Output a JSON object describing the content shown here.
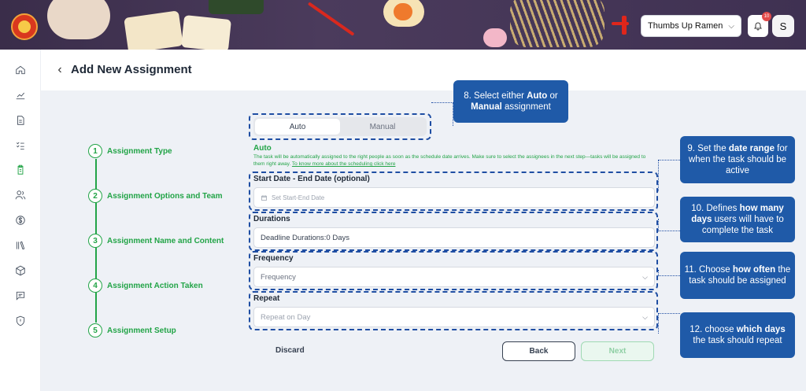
{
  "header": {
    "store_selector": "Thumbs Up Ramen",
    "notification_count": "10",
    "avatar_initial": "S"
  },
  "page": {
    "title": "Add New Assignment"
  },
  "sidebar": {
    "items": [
      {
        "icon": "home-icon"
      },
      {
        "icon": "chart-icon"
      },
      {
        "icon": "document-icon"
      },
      {
        "icon": "checklist-icon"
      },
      {
        "icon": "clipboard-icon",
        "active": true
      },
      {
        "icon": "users-icon"
      },
      {
        "icon": "dollar-icon"
      },
      {
        "icon": "books-icon"
      },
      {
        "icon": "box-icon"
      },
      {
        "icon": "chat-icon"
      },
      {
        "icon": "shield-icon"
      }
    ]
  },
  "steps": [
    {
      "number": "1",
      "label": "Assignment Type"
    },
    {
      "number": "2",
      "label": "Assignment Options and Team"
    },
    {
      "number": "3",
      "label": "Assignment Name and Content"
    },
    {
      "number": "4",
      "label": "Assignment Action Taken"
    },
    {
      "number": "5",
      "label": "Assignment Setup"
    }
  ],
  "assignment_type": {
    "auto_label": "Auto",
    "manual_label": "Manual",
    "selected": "Auto",
    "selected_title": "Auto",
    "description": "The task will be automatically assigned to the right people as soon as the schedule date arrives. Make sure to select the assignees in the next step—tasks will be assigned to them right away.",
    "link_text": "To know more about the scheduling click here"
  },
  "fields": {
    "date_range": {
      "label": "Start Date - End Date (optional)",
      "placeholder": "Set Start-End Date"
    },
    "durations": {
      "label": "Durations",
      "value": "Deadline Durations:0 Days"
    },
    "frequency": {
      "label": "Frequency",
      "value": "Frequency"
    },
    "repeat": {
      "label": "Repeat",
      "placeholder": "Repeat on Day"
    }
  },
  "actions": {
    "discard": "Discard",
    "back": "Back",
    "next": "Next"
  },
  "callouts": {
    "c8": {
      "pre": "8. Select either ",
      "b1": "Auto",
      "mid": " or",
      "b2": "Manual",
      "post": " assignment"
    },
    "c9": {
      "pre": "9. Set the ",
      "b": "date range",
      "post": " for when the task should be active"
    },
    "c10": {
      "pre": "10. Defines ",
      "b": "how many days",
      "post": " users will have to complete the task"
    },
    "c11": {
      "pre": "11. Choose ",
      "b": "how often",
      "post": " the task should be assigned"
    },
    "c12": {
      "pre": "12. choose ",
      "b": "which days",
      "post": " the task should repeat"
    }
  },
  "colors": {
    "accent_green": "#22a447",
    "callout_blue": "#1f5aa8",
    "banner": "#3f3152"
  }
}
